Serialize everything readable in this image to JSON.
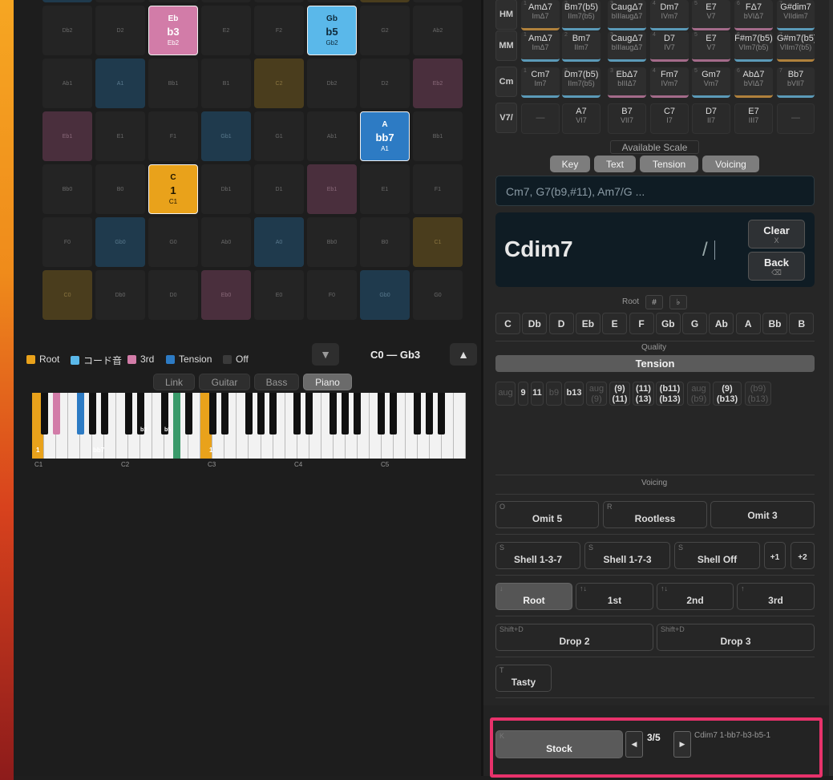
{
  "grid": {
    "rows": [
      [
        "",
        "",
        "Eb2",
        "",
        "",
        "Gb2",
        "",
        ""
      ],
      [
        "Db2",
        "D2",
        "Eb2",
        "E2",
        "F2",
        "Gb2",
        "G2",
        "Ab2"
      ],
      [
        "Ab1",
        "A1",
        "Bb1",
        "B1",
        "C2",
        "Db2",
        "D2",
        "Eb2"
      ],
      [
        "Eb1",
        "E1",
        "F1",
        "Gb1",
        "G1",
        "Ab1",
        "A1",
        "Bb1"
      ],
      [
        "Bb0",
        "B0",
        "C1",
        "Db1",
        "D1",
        "Eb1",
        "E1",
        "F1"
      ],
      [
        "F0",
        "Gb0",
        "G0",
        "Ab0",
        "A0",
        "Bb0",
        "B0",
        "C1"
      ],
      [
        "C0",
        "Db0",
        "D0",
        "Eb0",
        "E0",
        "F0",
        "Gb0",
        "G0"
      ]
    ],
    "highlighted": [
      {
        "top": "Eb",
        "main": "b3",
        "bottom": "Eb2"
      },
      {
        "top": "Gb",
        "main": "b5",
        "bottom": "Gb2"
      },
      {
        "top": "A",
        "main": "bb7",
        "bottom": "A1"
      },
      {
        "top": "C",
        "main": "1",
        "bottom": "C1"
      }
    ]
  },
  "legend": [
    {
      "label": "Root",
      "color": "#e9a21b"
    },
    {
      "label": "コード音",
      "color": "#5ab8ea"
    },
    {
      "label": "3rd",
      "color": "#d27ca8"
    },
    {
      "label": "Tension",
      "color": "#2d7bc4"
    },
    {
      "label": "Off",
      "color": "#3a3a3a"
    }
  ],
  "range_label": "C0 — Gb3",
  "down_arrow": "▼",
  "up_arrow": "▲",
  "instruments": [
    "Link",
    "Guitar",
    "Bass",
    "Piano"
  ],
  "selected_instrument": "Piano",
  "piano": {
    "octave_labels": [
      "C1",
      "C2",
      "C3",
      "C4",
      "C5"
    ],
    "key_labels": [
      "1",
      "bb7",
      "b3",
      "b5",
      "1"
    ]
  },
  "diatonic": {
    "rows": [
      {
        "label": "HM",
        "chords": [
          [
            "AmΔ7",
            "ImΔ7"
          ],
          [
            "Bm7(b5)",
            "IIm7(b5)"
          ],
          [
            "CaugΔ7",
            "bIIIaugΔ7"
          ],
          [
            "Dm7",
            "IVm7"
          ],
          [
            "E7",
            "V7"
          ],
          [
            "FΔ7",
            "bVIΔ7"
          ],
          [
            "G#dim7",
            "VIIdim7"
          ]
        ]
      },
      {
        "label": "MM",
        "chords": [
          [
            "AmΔ7",
            "ImΔ7"
          ],
          [
            "Bm7",
            "IIm7"
          ],
          [
            "CaugΔ7",
            "bIIIaugΔ7"
          ],
          [
            "D7",
            "IV7"
          ],
          [
            "E7",
            "V7"
          ],
          [
            "F#m7(b5)",
            "VIm7(b5)"
          ],
          [
            "G#m7(b5)",
            "VIIm7(b5)"
          ]
        ]
      },
      {
        "label": "Cm",
        "chords": [
          [
            "Cm7",
            "Im7"
          ],
          [
            "Dm7(b5)",
            "IIm7(b5)"
          ],
          [
            "EbΔ7",
            "bIIIΔ7"
          ],
          [
            "Fm7",
            "IVm7"
          ],
          [
            "Gm7",
            "Vm7"
          ],
          [
            "AbΔ7",
            "bVIΔ7"
          ],
          [
            "Bb7",
            "bVII7"
          ]
        ]
      },
      {
        "label": "V7/",
        "chords": [
          [
            "—",
            ""
          ],
          [
            "A7",
            "VI7"
          ],
          [
            "B7",
            "VII7"
          ],
          [
            "C7",
            "I7"
          ],
          [
            "D7",
            "II7"
          ],
          [
            "E7",
            "III7"
          ],
          [
            "—",
            ""
          ]
        ]
      }
    ]
  },
  "available_scale": "Available Scale",
  "tabs": [
    "Key",
    "Text",
    "Tension",
    "Voicing"
  ],
  "text_input_placeholder": "Cm7, G7(b9,#11), Am7/G ...",
  "chord_display": {
    "name": "Cdim7",
    "slash": "/"
  },
  "clear": {
    "label": "Clear",
    "key": "X"
  },
  "back": {
    "label": "Back",
    "key": "⌫"
  },
  "root": {
    "label": "Root",
    "sharp": "#",
    "flat": "♭",
    "notes": [
      "C",
      "Db",
      "D",
      "Eb",
      "E",
      "F",
      "Gb",
      "G",
      "Ab",
      "A",
      "Bb",
      "B"
    ]
  },
  "quality": {
    "label": "Quality",
    "selected": "Tension"
  },
  "tensions": [
    {
      "t1": "aug",
      "t2": ""
    },
    {
      "t1": "9",
      "t2": ""
    },
    {
      "t1": "11",
      "t2": ""
    },
    {
      "t1": "b9",
      "t2": ""
    },
    {
      "t1": "b13",
      "t2": ""
    },
    {
      "t1": "aug",
      "t2": "(9)"
    },
    {
      "t1": "(9)",
      "t2": "(11)"
    },
    {
      "t1": "(11)",
      "t2": "(13)"
    },
    {
      "t1": "(b11)",
      "t2": "(b13)"
    },
    {
      "t1": "aug",
      "t2": "(b9)"
    },
    {
      "t1": "(9)",
      "t2": "(b13)"
    },
    {
      "t1": "(b9)",
      "t2": "(b13)"
    }
  ],
  "voicing": {
    "label": "Voicing",
    "omit": [
      {
        "key": "O",
        "label": "Omit 5"
      },
      {
        "key": "R",
        "label": "Rootless"
      },
      {
        "key": "",
        "label": "Omit 3"
      }
    ],
    "shell": [
      {
        "key": "S",
        "label": "Shell 1-3-7"
      },
      {
        "key": "S",
        "label": "Shell 1-7-3"
      },
      {
        "key": "S",
        "label": "Shell Off"
      }
    ],
    "plus": [
      "+1",
      "+2"
    ],
    "inversions": [
      {
        "key": "↓",
        "label": "Root"
      },
      {
        "key": "↑↓",
        "label": "1st"
      },
      {
        "key": "↑↓",
        "label": "2nd"
      },
      {
        "key": "↑",
        "label": "3rd"
      }
    ],
    "drops": [
      {
        "key": "Shift+D",
        "label": "Drop 2"
      },
      {
        "key": "Shift+D",
        "label": "Drop 3"
      }
    ],
    "tasty": {
      "key": "T",
      "label": "Tasty"
    }
  },
  "stock": {
    "key": "K",
    "label": "Stock",
    "page": "3/5",
    "prev": "◀",
    "next": "▶",
    "preview": "Cdim7 1-bb7-b3-b5-1"
  }
}
